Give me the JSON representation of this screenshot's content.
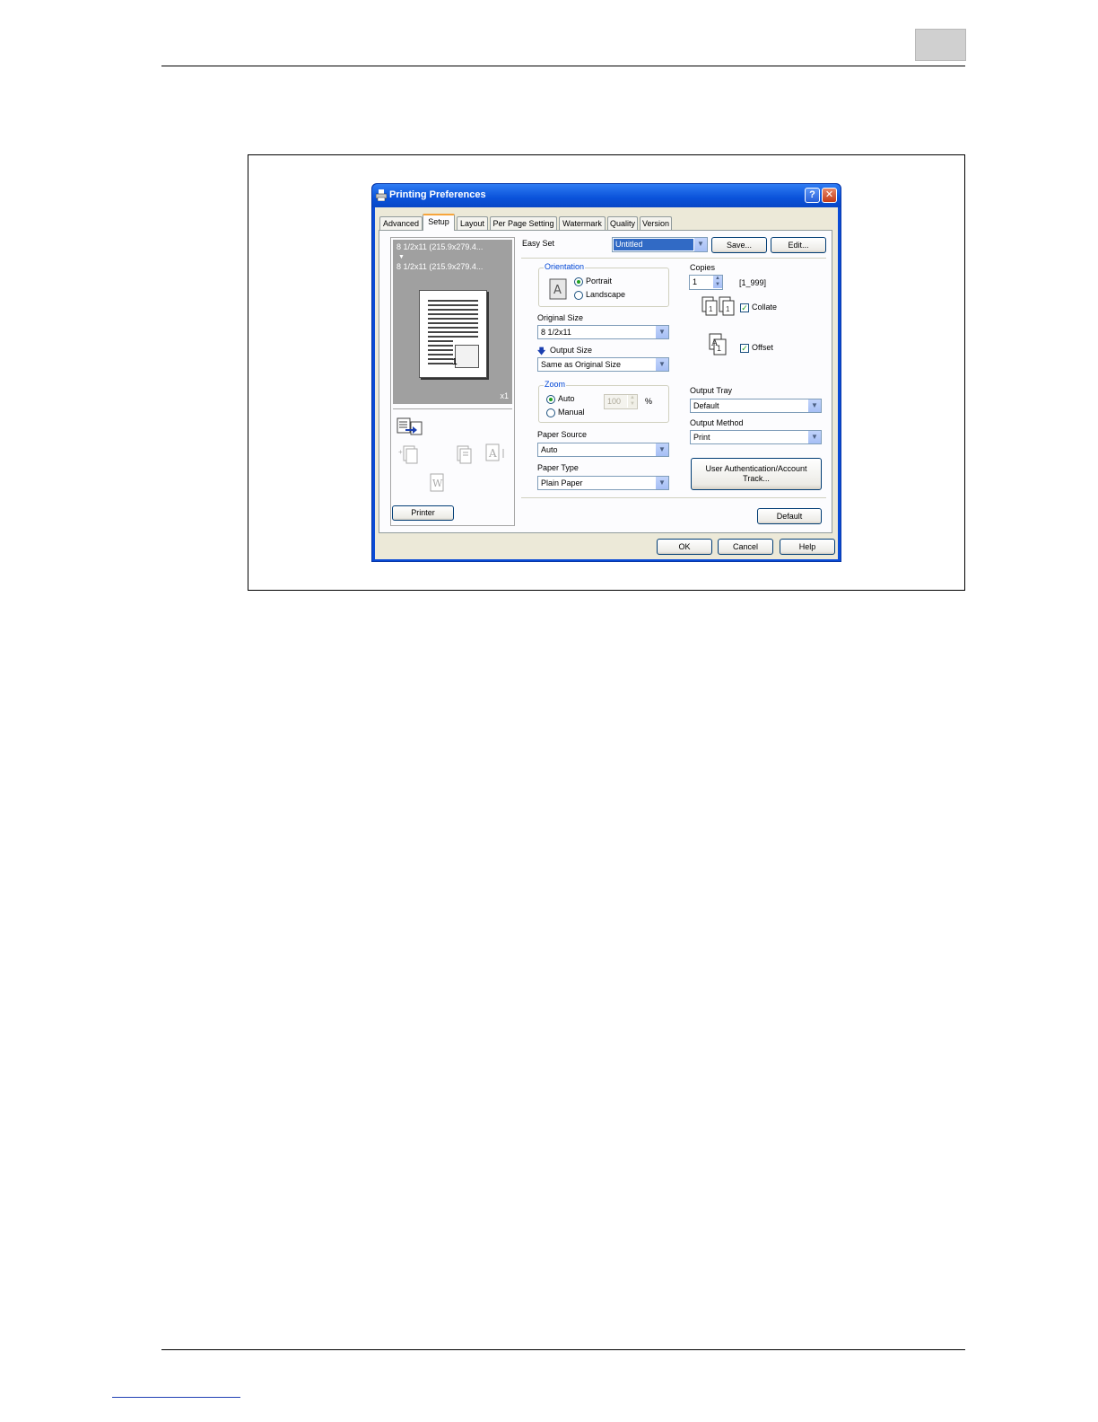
{
  "dialog": {
    "title": "Printing Preferences",
    "help_glyph": "?",
    "close_glyph": "✕"
  },
  "tabs": [
    "Advanced",
    "Setup",
    "Layout",
    "Per Page Setting",
    "Watermark",
    "Quality",
    "Version"
  ],
  "active_tab": "Setup",
  "preview": {
    "original_size": "8 1/2x11 (215.9x279.4...",
    "output_size": "8 1/2x11 (215.9x279.4...",
    "page_number": "1",
    "copies_badge": "x1",
    "printer_button": "Printer"
  },
  "easy_set": {
    "label": "Easy Set",
    "value": "Untitled",
    "save_button": "Save...",
    "edit_button": "Edit..."
  },
  "orientation": {
    "group_label": "Orientation",
    "portrait": "Portrait",
    "landscape": "Landscape",
    "selected": "Portrait"
  },
  "original_size": {
    "label": "Original Size",
    "value": "8 1/2x11"
  },
  "output_size": {
    "label": "Output Size",
    "value": "Same as Original Size"
  },
  "zoom": {
    "group_label": "Zoom",
    "auto": "Auto",
    "manual": "Manual",
    "value": "100",
    "unit": "%",
    "selected": "Auto"
  },
  "paper_source": {
    "label": "Paper Source",
    "value": "Auto"
  },
  "paper_type": {
    "label": "Paper Type",
    "value": "Plain Paper"
  },
  "copies": {
    "label": "Copies",
    "value": "1",
    "range": "[1_999]"
  },
  "collate": {
    "label": "Collate",
    "checked": true
  },
  "offset": {
    "label": "Offset",
    "checked": true
  },
  "output_tray": {
    "label": "Output Tray",
    "value": "Default"
  },
  "output_method": {
    "label": "Output Method",
    "value": "Print"
  },
  "auth_button": "User Authentication/Account Track...",
  "default_button": "Default",
  "footer_buttons": {
    "ok": "OK",
    "cancel": "Cancel",
    "help": "Help"
  },
  "colors": {
    "titlebar": "#0a52da",
    "dialog_face": "#ece9d8",
    "tab_accent": "#f7a53b",
    "selected_highlight": "#316ac5"
  }
}
